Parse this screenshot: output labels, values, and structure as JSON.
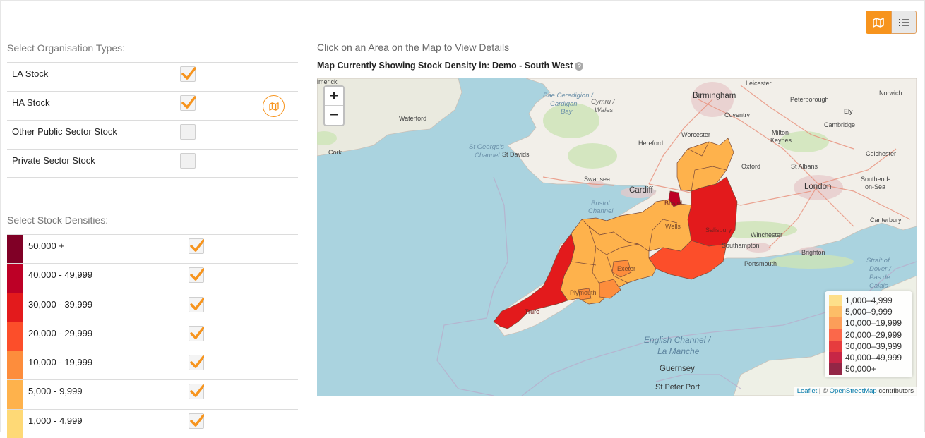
{
  "view_toggle": {
    "map_icon": "map-icon",
    "list_icon": "list-icon",
    "accent": "#f7941d"
  },
  "org_section": {
    "title": "Select Organisation Types:",
    "items": [
      {
        "label": "LA Stock",
        "checked": true
      },
      {
        "label": "HA Stock",
        "checked": true
      },
      {
        "label": "Other Public Sector Stock",
        "checked": false
      },
      {
        "label": "Private Sector Stock",
        "checked": false
      }
    ]
  },
  "density_section": {
    "title": "Select Stock Densities:",
    "items": [
      {
        "label": "50,000 +",
        "color": "#800026",
        "checked": true
      },
      {
        "label": "40,000 - 49,999",
        "color": "#bd0026",
        "checked": true
      },
      {
        "label": "30,000 - 39,999",
        "color": "#e31a1c",
        "checked": true
      },
      {
        "label": "20,000 - 29,999",
        "color": "#fc4e2a",
        "checked": true
      },
      {
        "label": "10,000 - 19,999",
        "color": "#fd8d3c",
        "checked": true
      },
      {
        "label": "5,000 - 9,999",
        "color": "#feb24c",
        "checked": true
      },
      {
        "label": "1,000 - 4,999",
        "color": "#fed976",
        "checked": true
      }
    ]
  },
  "map": {
    "hint": "Click on an Area on the Map to View Details",
    "heading": "Map Currently Showing Stock Density in: Demo - South West",
    "zoom_in": "+",
    "zoom_out": "−",
    "legend": [
      {
        "label": "1,000–4,999",
        "color": "#fed976"
      },
      {
        "label": "5,000–9,999",
        "color": "#feb24c"
      },
      {
        "label": "10,000–19,999",
        "color": "#fd8d3c"
      },
      {
        "label": "20,000–29,999",
        "color": "#fc4e2a"
      },
      {
        "label": "30,000–39,999",
        "color": "#e31a1c"
      },
      {
        "label": "40,000–49,999",
        "color": "#bd0026"
      },
      {
        "label": "50,000+",
        "color": "#800026"
      }
    ],
    "attribution": {
      "leaflet": "Leaflet",
      "separator": " | © ",
      "osm": "OpenStreetMap",
      "suffix": " contributors"
    },
    "places": {
      "limerick": "imerick",
      "waterford": "Waterford",
      "cork": "Cork",
      "st_georges": "St George's",
      "channel": "Channel",
      "bae": "Bae Ceredigion /",
      "cardigan": "Cardigan",
      "bay": "Bay",
      "cymru": "Cymru /",
      "wales": "Wales",
      "st_davids": "St Davids",
      "swansea": "Swansea",
      "cardiff": "Cardiff",
      "bristol_channel_1": "Bristol",
      "bristol_channel_2": "Channel",
      "birmingham": "Birmingham",
      "leicester": "Leicester",
      "norwich": "Norwich",
      "peterborough": "Peterborough",
      "coventry": "Coventry",
      "ely": "Ely",
      "worcester": "Worcester",
      "cambridge": "Cambridge",
      "hereford": "Hereford",
      "milton_keynes_1": "Milton",
      "milton_keynes_2": "Keynes",
      "colchester": "Colchester",
      "oxford": "Oxford",
      "st_albans": "St Albans",
      "london": "London",
      "southend_1": "Southend-",
      "southend_2": "on-Sea",
      "canterbury": "Canterbury",
      "winchester": "Winchester",
      "southampton": "Southampton",
      "brighton": "Brighton",
      "portsmouth": "Portsmouth",
      "salisbury": "Salisbury",
      "exeter": "Exeter",
      "plymouth": "Plymouth",
      "truro": "Truro",
      "bristol": "Bristol",
      "wells": "Wells",
      "dover_1": "Strait of",
      "dover_2": "Dover /",
      "dover_3": "Pas de",
      "dover_4": "Calais",
      "english_channel_1": "English Channel /",
      "english_channel_2": "La Manche",
      "guernsey": "Guernsey",
      "st_peter_port": "St Peter Port"
    }
  }
}
